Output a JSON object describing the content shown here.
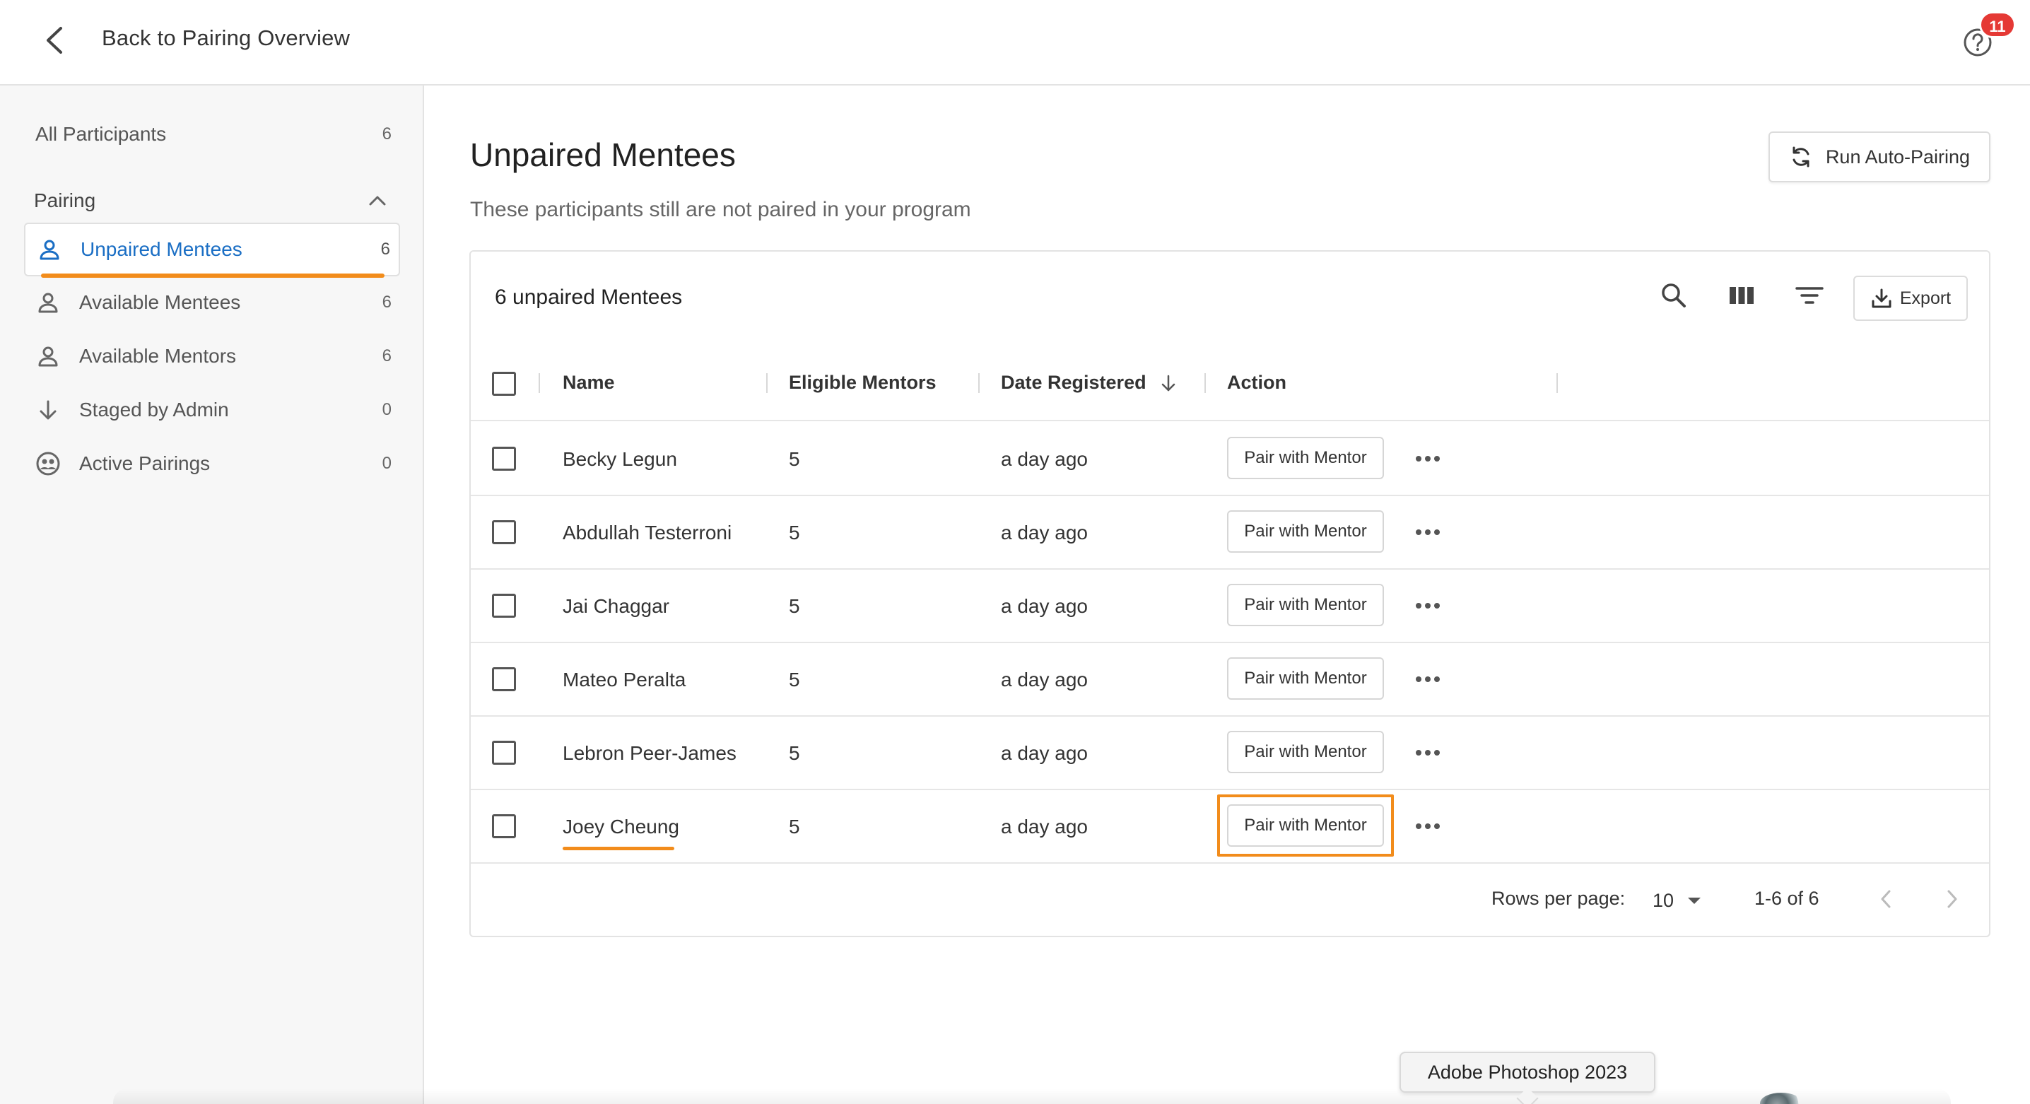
{
  "header": {
    "back_label": "Back to Pairing Overview",
    "notification_count": "11"
  },
  "sidebar": {
    "all_participants": {
      "label": "All Participants",
      "count": "6"
    },
    "section_label": "Pairing",
    "items": [
      {
        "label": "Unpaired Mentees",
        "count": "6",
        "icon": "person-icon"
      },
      {
        "label": "Available Mentees",
        "count": "6",
        "icon": "person-icon"
      },
      {
        "label": "Available Mentors",
        "count": "6",
        "icon": "person-icon"
      },
      {
        "label": "Staged by Admin",
        "count": "0",
        "icon": "arrow-down-icon"
      },
      {
        "label": "Active Pairings",
        "count": "0",
        "icon": "pairing-icon"
      }
    ]
  },
  "main": {
    "title": "Unpaired Mentees",
    "subtitle": "These participants still are not paired in your program",
    "auto_pair_label": "Run Auto-Pairing"
  },
  "table": {
    "caption": "6 unpaired Mentees",
    "export_label": "Export",
    "columns": {
      "name": "Name",
      "eligible": "Eligible Mentors",
      "date": "Date Registered",
      "action": "Action"
    },
    "rows": [
      {
        "name": "Becky Legun",
        "eligible": "5",
        "date": "a day ago",
        "action": "Pair with Mentor"
      },
      {
        "name": "Abdullah Testerroni",
        "eligible": "5",
        "date": "a day ago",
        "action": "Pair with Mentor"
      },
      {
        "name": "Jai Chaggar",
        "eligible": "5",
        "date": "a day ago",
        "action": "Pair with Mentor"
      },
      {
        "name": "Mateo Peralta",
        "eligible": "5",
        "date": "a day ago",
        "action": "Pair with Mentor"
      },
      {
        "name": "Lebron Peer-James",
        "eligible": "5",
        "date": "a day ago",
        "action": "Pair with Mentor"
      },
      {
        "name": "Joey Cheung",
        "eligible": "5",
        "date": "a day ago",
        "action": "Pair with Mentor"
      }
    ],
    "footer": {
      "rows_per_page_label": "Rows per page:",
      "rows_per_page_value": "10",
      "range": "1-6 of 6"
    }
  },
  "dock": {
    "tooltip": "Adobe Photoshop 2023"
  },
  "colors": {
    "accent_blue": "#1a6ec4",
    "highlight_orange": "#f28c1b",
    "badge_red": "#e53935"
  }
}
